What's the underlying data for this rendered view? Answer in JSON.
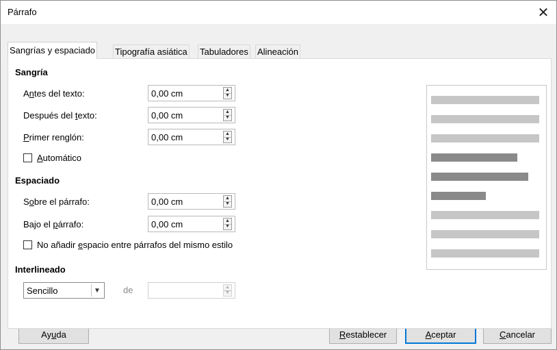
{
  "window": {
    "title": "Párrafo",
    "close_glyph": "✕"
  },
  "tabs": [
    {
      "label": "Sangrías y espaciado",
      "active": true
    },
    {
      "label": "Tipografía asiática",
      "active": false
    },
    {
      "label": "Tabuladores",
      "active": false
    },
    {
      "label": "Alineación",
      "active": false
    }
  ],
  "indent": {
    "heading": "Sangría",
    "before_text": {
      "label_pre": "A",
      "label_acc": "n",
      "label_post": "tes del texto:",
      "value": "0,00 cm"
    },
    "after_text": {
      "label_pre": "Después del ",
      "label_acc": "t",
      "label_post": "exto:",
      "value": "0,00 cm"
    },
    "first_line": {
      "label_pre": "",
      "label_acc": "P",
      "label_post": "rimer renglón:",
      "value": "0,00 cm"
    },
    "automatic": {
      "label_pre": "",
      "label_acc": "A",
      "label_post": "utomático",
      "checked": false
    }
  },
  "spacing": {
    "heading": "Espaciado",
    "above": {
      "label_pre": "S",
      "label_acc": "o",
      "label_post": "bre el párrafo:",
      "value": "0,00 cm"
    },
    "below": {
      "label_pre": "Bajo el ",
      "label_acc": "p",
      "label_post": "árrafo:",
      "value": "0,00 cm"
    },
    "no_space": {
      "label_pre": "No añadir ",
      "label_acc": "e",
      "label_post": "spacio entre párrafos del mismo estilo",
      "checked": false
    }
  },
  "line_spacing": {
    "heading": "Interlineado",
    "selected": "Sencillo",
    "of_label": "de",
    "value": ""
  },
  "buttons": {
    "help": {
      "pre": "Ay",
      "acc": "u",
      "post": "da"
    },
    "reset": {
      "pre": "",
      "acc": "R",
      "post": "establecer"
    },
    "ok": {
      "pre": "",
      "acc": "A",
      "post": "ceptar"
    },
    "cancel": {
      "pre": "",
      "acc": "C",
      "post": "ancelar"
    }
  },
  "colors": {
    "accent": "#0078d7",
    "preview_light": "#c6c6c6",
    "preview_dark": "#8a8a8a"
  }
}
